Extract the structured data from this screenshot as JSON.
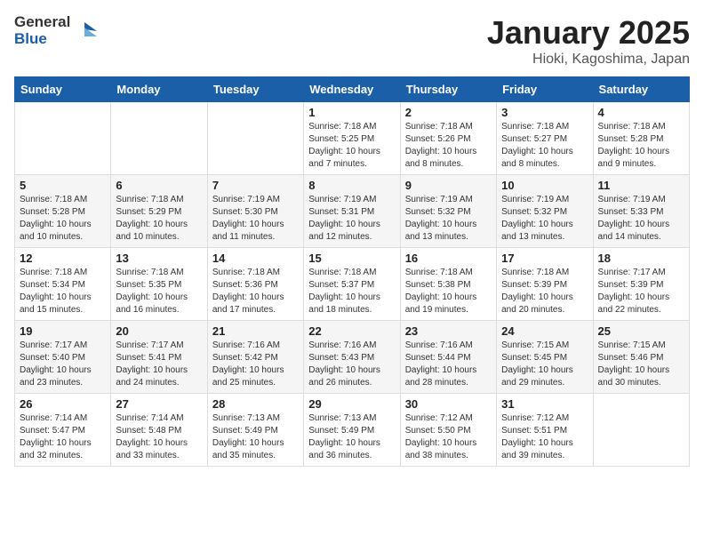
{
  "header": {
    "logo_general": "General",
    "logo_blue": "Blue",
    "title": "January 2025",
    "subtitle": "Hioki, Kagoshima, Japan"
  },
  "weekdays": [
    "Sunday",
    "Monday",
    "Tuesday",
    "Wednesday",
    "Thursday",
    "Friday",
    "Saturday"
  ],
  "weeks": [
    [
      {
        "day": "",
        "sunrise": "",
        "sunset": "",
        "daylight": ""
      },
      {
        "day": "",
        "sunrise": "",
        "sunset": "",
        "daylight": ""
      },
      {
        "day": "",
        "sunrise": "",
        "sunset": "",
        "daylight": ""
      },
      {
        "day": "1",
        "sunrise": "Sunrise: 7:18 AM",
        "sunset": "Sunset: 5:25 PM",
        "daylight": "Daylight: 10 hours and 7 minutes."
      },
      {
        "day": "2",
        "sunrise": "Sunrise: 7:18 AM",
        "sunset": "Sunset: 5:26 PM",
        "daylight": "Daylight: 10 hours and 8 minutes."
      },
      {
        "day": "3",
        "sunrise": "Sunrise: 7:18 AM",
        "sunset": "Sunset: 5:27 PM",
        "daylight": "Daylight: 10 hours and 8 minutes."
      },
      {
        "day": "4",
        "sunrise": "Sunrise: 7:18 AM",
        "sunset": "Sunset: 5:28 PM",
        "daylight": "Daylight: 10 hours and 9 minutes."
      }
    ],
    [
      {
        "day": "5",
        "sunrise": "Sunrise: 7:18 AM",
        "sunset": "Sunset: 5:28 PM",
        "daylight": "Daylight: 10 hours and 10 minutes."
      },
      {
        "day": "6",
        "sunrise": "Sunrise: 7:18 AM",
        "sunset": "Sunset: 5:29 PM",
        "daylight": "Daylight: 10 hours and 10 minutes."
      },
      {
        "day": "7",
        "sunrise": "Sunrise: 7:19 AM",
        "sunset": "Sunset: 5:30 PM",
        "daylight": "Daylight: 10 hours and 11 minutes."
      },
      {
        "day": "8",
        "sunrise": "Sunrise: 7:19 AM",
        "sunset": "Sunset: 5:31 PM",
        "daylight": "Daylight: 10 hours and 12 minutes."
      },
      {
        "day": "9",
        "sunrise": "Sunrise: 7:19 AM",
        "sunset": "Sunset: 5:32 PM",
        "daylight": "Daylight: 10 hours and 13 minutes."
      },
      {
        "day": "10",
        "sunrise": "Sunrise: 7:19 AM",
        "sunset": "Sunset: 5:32 PM",
        "daylight": "Daylight: 10 hours and 13 minutes."
      },
      {
        "day": "11",
        "sunrise": "Sunrise: 7:19 AM",
        "sunset": "Sunset: 5:33 PM",
        "daylight": "Daylight: 10 hours and 14 minutes."
      }
    ],
    [
      {
        "day": "12",
        "sunrise": "Sunrise: 7:18 AM",
        "sunset": "Sunset: 5:34 PM",
        "daylight": "Daylight: 10 hours and 15 minutes."
      },
      {
        "day": "13",
        "sunrise": "Sunrise: 7:18 AM",
        "sunset": "Sunset: 5:35 PM",
        "daylight": "Daylight: 10 hours and 16 minutes."
      },
      {
        "day": "14",
        "sunrise": "Sunrise: 7:18 AM",
        "sunset": "Sunset: 5:36 PM",
        "daylight": "Daylight: 10 hours and 17 minutes."
      },
      {
        "day": "15",
        "sunrise": "Sunrise: 7:18 AM",
        "sunset": "Sunset: 5:37 PM",
        "daylight": "Daylight: 10 hours and 18 minutes."
      },
      {
        "day": "16",
        "sunrise": "Sunrise: 7:18 AM",
        "sunset": "Sunset: 5:38 PM",
        "daylight": "Daylight: 10 hours and 19 minutes."
      },
      {
        "day": "17",
        "sunrise": "Sunrise: 7:18 AM",
        "sunset": "Sunset: 5:39 PM",
        "daylight": "Daylight: 10 hours and 20 minutes."
      },
      {
        "day": "18",
        "sunrise": "Sunrise: 7:17 AM",
        "sunset": "Sunset: 5:39 PM",
        "daylight": "Daylight: 10 hours and 22 minutes."
      }
    ],
    [
      {
        "day": "19",
        "sunrise": "Sunrise: 7:17 AM",
        "sunset": "Sunset: 5:40 PM",
        "daylight": "Daylight: 10 hours and 23 minutes."
      },
      {
        "day": "20",
        "sunrise": "Sunrise: 7:17 AM",
        "sunset": "Sunset: 5:41 PM",
        "daylight": "Daylight: 10 hours and 24 minutes."
      },
      {
        "day": "21",
        "sunrise": "Sunrise: 7:16 AM",
        "sunset": "Sunset: 5:42 PM",
        "daylight": "Daylight: 10 hours and 25 minutes."
      },
      {
        "day": "22",
        "sunrise": "Sunrise: 7:16 AM",
        "sunset": "Sunset: 5:43 PM",
        "daylight": "Daylight: 10 hours and 26 minutes."
      },
      {
        "day": "23",
        "sunrise": "Sunrise: 7:16 AM",
        "sunset": "Sunset: 5:44 PM",
        "daylight": "Daylight: 10 hours and 28 minutes."
      },
      {
        "day": "24",
        "sunrise": "Sunrise: 7:15 AM",
        "sunset": "Sunset: 5:45 PM",
        "daylight": "Daylight: 10 hours and 29 minutes."
      },
      {
        "day": "25",
        "sunrise": "Sunrise: 7:15 AM",
        "sunset": "Sunset: 5:46 PM",
        "daylight": "Daylight: 10 hours and 30 minutes."
      }
    ],
    [
      {
        "day": "26",
        "sunrise": "Sunrise: 7:14 AM",
        "sunset": "Sunset: 5:47 PM",
        "daylight": "Daylight: 10 hours and 32 minutes."
      },
      {
        "day": "27",
        "sunrise": "Sunrise: 7:14 AM",
        "sunset": "Sunset: 5:48 PM",
        "daylight": "Daylight: 10 hours and 33 minutes."
      },
      {
        "day": "28",
        "sunrise": "Sunrise: 7:13 AM",
        "sunset": "Sunset: 5:49 PM",
        "daylight": "Daylight: 10 hours and 35 minutes."
      },
      {
        "day": "29",
        "sunrise": "Sunrise: 7:13 AM",
        "sunset": "Sunset: 5:49 PM",
        "daylight": "Daylight: 10 hours and 36 minutes."
      },
      {
        "day": "30",
        "sunrise": "Sunrise: 7:12 AM",
        "sunset": "Sunset: 5:50 PM",
        "daylight": "Daylight: 10 hours and 38 minutes."
      },
      {
        "day": "31",
        "sunrise": "Sunrise: 7:12 AM",
        "sunset": "Sunset: 5:51 PM",
        "daylight": "Daylight: 10 hours and 39 minutes."
      },
      {
        "day": "",
        "sunrise": "",
        "sunset": "",
        "daylight": ""
      }
    ]
  ]
}
